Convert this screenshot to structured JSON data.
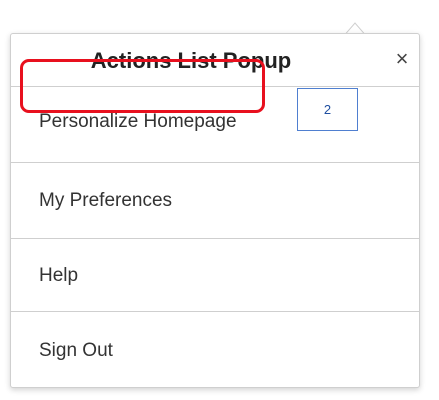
{
  "popup": {
    "title": "Actions List Popup",
    "close_glyph": "×",
    "close_icon": "close-icon",
    "items": [
      {
        "label": "Personalize Homepage"
      },
      {
        "label": "My Preferences"
      },
      {
        "label": "Help"
      },
      {
        "label": "Sign Out"
      }
    ]
  },
  "annotation": {
    "step_number": "2",
    "highlight_color": "#e8101e",
    "badge_border_color": "#4f7fd0"
  }
}
